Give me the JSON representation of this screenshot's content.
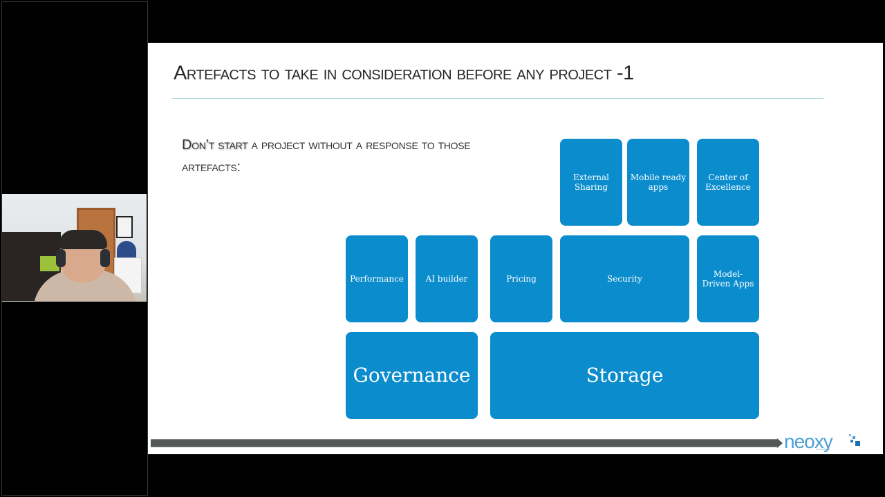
{
  "webcam": {
    "label": "presenter webcam feed"
  },
  "slide": {
    "title_first": "A",
    "title_rest": "rtefacts to take in consideration before any project -1",
    "subtitle_emph": "Don’t start",
    "subtitle_rest": " a project without a response to those artefacts:",
    "accent_color": "#0a8ccd",
    "boxes": {
      "external_sharing": "External Sharing",
      "mobile_ready_apps": "Mobile ready apps",
      "center_of_excellence": "Center of Excellence",
      "performance": "Performance",
      "ai_builder": "AI builder",
      "pricing": "Pricing",
      "security": "Security",
      "model_driven_apps": "Model-Driven Apps",
      "governance": "Governance",
      "storage": "Storage"
    },
    "logo": {
      "name": "neoxy",
      "tagline": "consultancy"
    }
  }
}
